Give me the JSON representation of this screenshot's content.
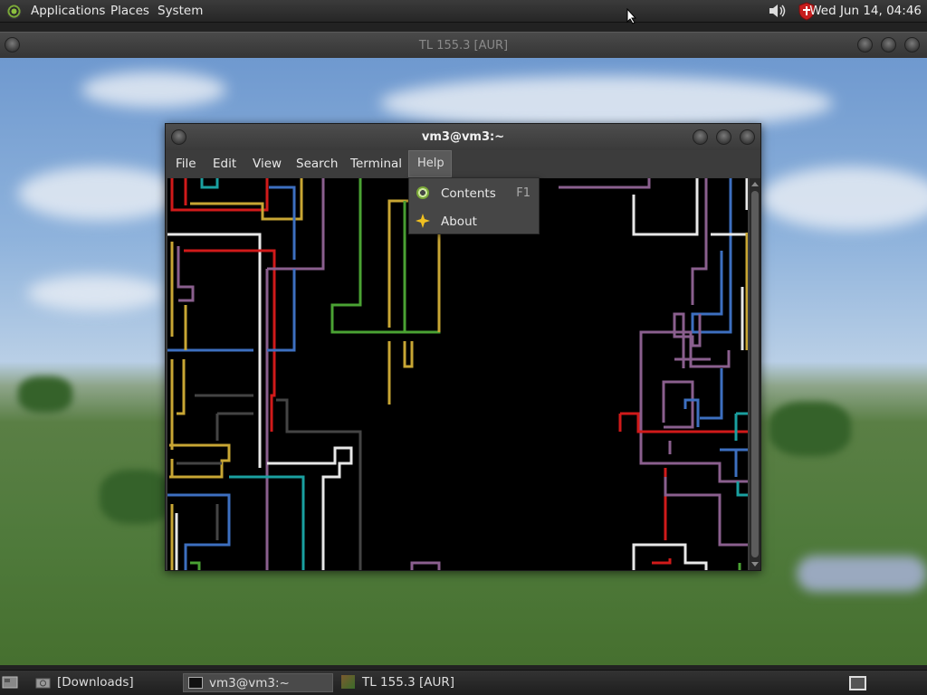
{
  "top_panel": {
    "menus": [
      "Applications",
      "Places",
      "System"
    ],
    "clock": "Wed Jun 14, 04:46",
    "icons": [
      "app-logo-icon",
      "volume-icon",
      "shield-icon",
      "mouse-cursor-icon"
    ]
  },
  "bg_window": {
    "title": "TL 155.3 [AUR]"
  },
  "terminal": {
    "title": "vm3@vm3:~",
    "menus": [
      "File",
      "Edit",
      "View",
      "Search",
      "Terminal",
      "Help"
    ]
  },
  "help_menu": {
    "items": [
      {
        "label": "Contents",
        "accel": "F1",
        "icon": "help-contents-icon"
      },
      {
        "label": "About",
        "accel": "",
        "icon": "about-star-icon"
      }
    ]
  },
  "taskbar": {
    "items": [
      {
        "label": "[Downloads]",
        "icon": "folder-icon",
        "active": false
      },
      {
        "label": "vm3@vm3:~",
        "icon": "terminal-icon",
        "active": true
      },
      {
        "label": "TL 155.3 [AUR]",
        "icon": "game-block-icon",
        "active": false
      }
    ]
  },
  "colors": {
    "pipe_red": "#d01a1a",
    "pipe_yellow": "#c8a634",
    "pipe_blue": "#3d6fc0",
    "pipe_purple": "#8a5f8e",
    "pipe_green": "#4aa233",
    "pipe_teal": "#1aa0a0",
    "pipe_white": "#e8e8e8",
    "pipe_gray": "#444444"
  }
}
